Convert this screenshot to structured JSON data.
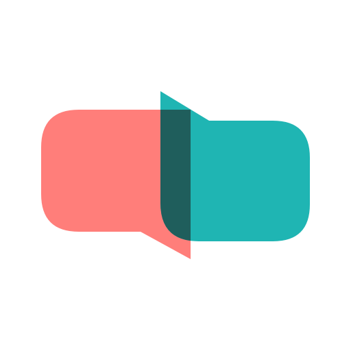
{
  "logo": {
    "name": "chat-bubbles-logo",
    "colors": {
      "background": "#ffffff",
      "left_bubble": "#ff7e7a",
      "right_bubble": "#1fb5b3",
      "overlap": "#1f5e5c"
    },
    "icons": {
      "left": "speech-bubble-icon",
      "right": "speech-bubble-icon"
    }
  }
}
